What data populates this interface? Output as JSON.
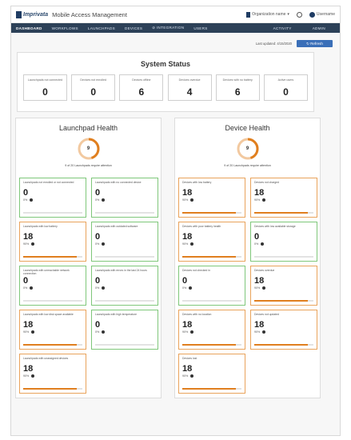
{
  "header": {
    "brand": "Imprivata",
    "app_title": "Mobile Access Management",
    "org_label": "Organization name",
    "user_label": "Username"
  },
  "nav": {
    "tabs": [
      "DASHBOARD",
      "WORKFLOWS",
      "LAUNCHPADS",
      "DEVICES",
      "INTEGRATION",
      "USERS"
    ],
    "right_tabs": [
      "ACTIVITY",
      "ADMIN"
    ]
  },
  "toolbar": {
    "last_updated": "Last updated: 4/15/2020",
    "refresh_label": "Refresh"
  },
  "status": {
    "title": "System Status",
    "boxes": [
      {
        "label": "Launchpads not connected",
        "value": "0"
      },
      {
        "label": "Devices not enrolled",
        "value": "0"
      },
      {
        "label": "Devices offline",
        "value": "6"
      },
      {
        "label": "Devices overdue",
        "value": "4"
      },
      {
        "label": "Devices with no battery",
        "value": "6"
      },
      {
        "label": "Active users",
        "value": "0"
      }
    ]
  },
  "launchpad_health": {
    "title": "Launchpad Health",
    "score": "9",
    "score_fraction": 0.45,
    "subtitle": "9 of 20 Launchpads require attention",
    "cards": [
      {
        "title": "Launchpads not enrolled or not connected",
        "value": "0",
        "pct": "0%",
        "fill": 0,
        "status": "ok"
      },
      {
        "title": "Launchpads with no connected device",
        "value": "0",
        "pct": "0%",
        "fill": 0,
        "status": "ok"
      },
      {
        "title": "Launchpads with low battery",
        "value": "18",
        "pct": "90%",
        "fill": 0.9,
        "status": "warn"
      },
      {
        "title": "Launchpads with outdated software",
        "value": "0",
        "pct": "0%",
        "fill": 0,
        "status": "ok"
      },
      {
        "title": "Launchpads with unreachable network connection",
        "value": "0",
        "pct": "0%",
        "fill": 0,
        "status": "ok"
      },
      {
        "title": "Launchpads with errors in the last 24 hours",
        "value": "0",
        "pct": "0%",
        "fill": 0,
        "status": "ok"
      },
      {
        "title": "Launchpads with low disk space available",
        "value": "18",
        "pct": "90%",
        "fill": 0.9,
        "status": "warn"
      },
      {
        "title": "Launchpads with high temperature",
        "value": "0",
        "pct": "0%",
        "fill": 0,
        "status": "ok"
      },
      {
        "title": "Launchpads with unassigned devices",
        "value": "18",
        "pct": "90%",
        "fill": 0.9,
        "status": "warn"
      }
    ]
  },
  "device_health": {
    "title": "Device Health",
    "score": "9",
    "score_fraction": 0.45,
    "subtitle": "9 of 20 Launchpads require attention",
    "cards": [
      {
        "title": "Devices with low battery",
        "value": "18",
        "pct": "90%",
        "fill": 0.9,
        "status": "warn"
      },
      {
        "title": "Devices not charged",
        "value": "18",
        "pct": "90%",
        "fill": 0.9,
        "status": "warn"
      },
      {
        "title": "Devices with poor battery health",
        "value": "18",
        "pct": "90%",
        "fill": 0.9,
        "status": "warn"
      },
      {
        "title": "Devices with low available storage",
        "value": "0",
        "pct": "0%",
        "fill": 0,
        "status": "ok"
      },
      {
        "title": "Devices not checked in",
        "value": "0",
        "pct": "0%",
        "fill": 0,
        "status": "ok"
      },
      {
        "title": "Devices overdue",
        "value": "18",
        "pct": "90%",
        "fill": 0.9,
        "status": "warn"
      },
      {
        "title": "Devices with no location",
        "value": "18",
        "pct": "90%",
        "fill": 0.9,
        "status": "warn"
      },
      {
        "title": "Devices not updated",
        "value": "18",
        "pct": "90%",
        "fill": 0.9,
        "status": "warn"
      },
      {
        "title": "Devices lost",
        "value": "18",
        "pct": "90%",
        "fill": 0.9,
        "status": "warn"
      }
    ]
  }
}
